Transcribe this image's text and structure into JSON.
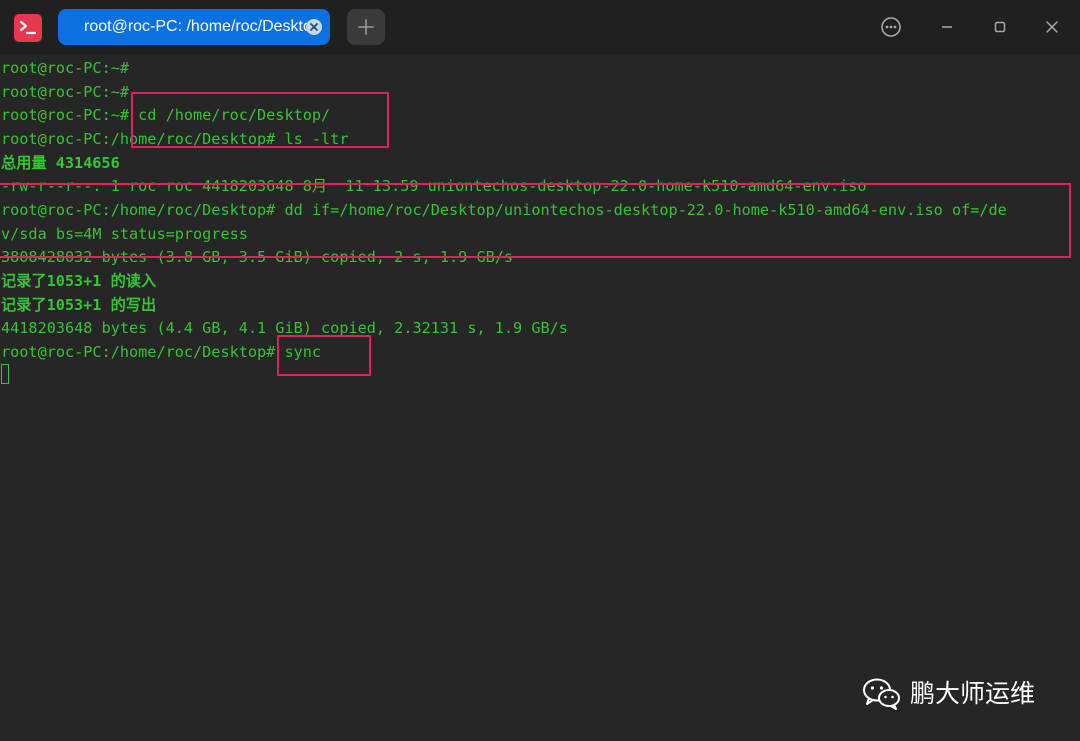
{
  "window": {
    "tab_title": "root@roc-PC: /home/roc/Desktop",
    "icons": {
      "app": "terminal-app-icon",
      "tab_close": "close-icon",
      "new_tab": "plus-icon",
      "menu": "more-options-icon",
      "minimize": "minimize-icon",
      "maximize": "maximize-icon",
      "close": "close-icon"
    },
    "colors": {
      "titlebar_bg": "#202020",
      "tab_active_bg": "#0b71e0",
      "terminal_bg": "#262626",
      "terminal_fg": "#33c533",
      "highlight_box": "#e0225a"
    }
  },
  "terminal": {
    "lines": [
      "root@roc-PC:~#",
      "root@roc-PC:~#",
      "root@roc-PC:~# cd /home/roc/Desktop/",
      "root@roc-PC:/home/roc/Desktop# ls -ltr",
      "总用量 4314656",
      "-rw-r--r--. 1 roc roc 4418203648 8月  11 13:59 uniontechos-desktop-22.0-home-k510-amd64-env.iso",
      "root@roc-PC:/home/roc/Desktop# dd if=/home/roc/Desktop/uniontechos-desktop-22.0-home-k510-amd64-env.iso of=/de",
      "v/sda bs=4M status=progress",
      "3808428032 bytes (3.8 GB, 3.5 GiB) copied, 2 s, 1.9 GB/s",
      "记录了1053+1 的读入",
      "记录了1053+1 的写出",
      "4418203648 bytes (4.4 GB, 4.1 GiB) copied, 2.32131 s, 1.9 GB/s",
      "root@roc-PC:/home/roc/Desktop# sync"
    ]
  },
  "watermark": {
    "icon": "wechat-icon",
    "text": "鹏大师运维"
  }
}
